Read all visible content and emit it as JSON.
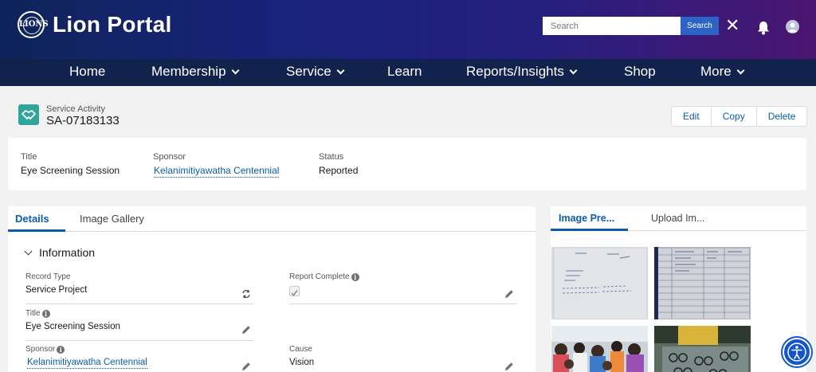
{
  "header": {
    "logo_seal_text": "LIONS",
    "app_title": "Lion Portal",
    "search_placeholder": "Search",
    "search_button": "Search",
    "close_glyph": "✕",
    "icons": [
      "bell-icon",
      "user-avatar-icon",
      "close-icon"
    ]
  },
  "nav": {
    "items": [
      {
        "label": "Home",
        "dropdown": false
      },
      {
        "label": "Membership",
        "dropdown": true
      },
      {
        "label": "Service",
        "dropdown": true
      },
      {
        "label": "Learn",
        "dropdown": false
      },
      {
        "label": "Reports/Insights",
        "dropdown": true
      },
      {
        "label": "Shop",
        "dropdown": false
      },
      {
        "label": "More",
        "dropdown": true
      }
    ]
  },
  "record": {
    "object_label": "Service Activity",
    "name": "SA-07183133",
    "icon": "handshake-icon",
    "icon_color": "#2fa59c",
    "actions": [
      "Edit",
      "Copy",
      "Delete"
    ]
  },
  "highlights": {
    "title_label": "Title",
    "title_value": "Eye Screening Session",
    "sponsor_label": "Sponsor",
    "sponsor_value": "Kelanimitiyawatha Centennial",
    "status_label": "Status",
    "status_value": "Reported"
  },
  "details": {
    "tabs": [
      "Details",
      "Image Gallery"
    ],
    "active_tab": "Details",
    "section_title": "Information",
    "fields": {
      "record_type_label": "Record Type",
      "record_type_value": "Service Project",
      "report_complete_label": "Report Complete",
      "report_complete_checked": true,
      "title_label": "Title",
      "title_value": "Eye Screening Session",
      "sponsor_label": "Sponsor",
      "sponsor_value": "Kelanimitiyawatha Centennial",
      "cause_label": "Cause",
      "cause_value": "Vision"
    }
  },
  "image_panel": {
    "tabs": [
      "Image Pre...",
      "Upload Im..."
    ],
    "active_tab": "Image Pre..."
  },
  "accessibility_button": "accessibility-icon"
}
